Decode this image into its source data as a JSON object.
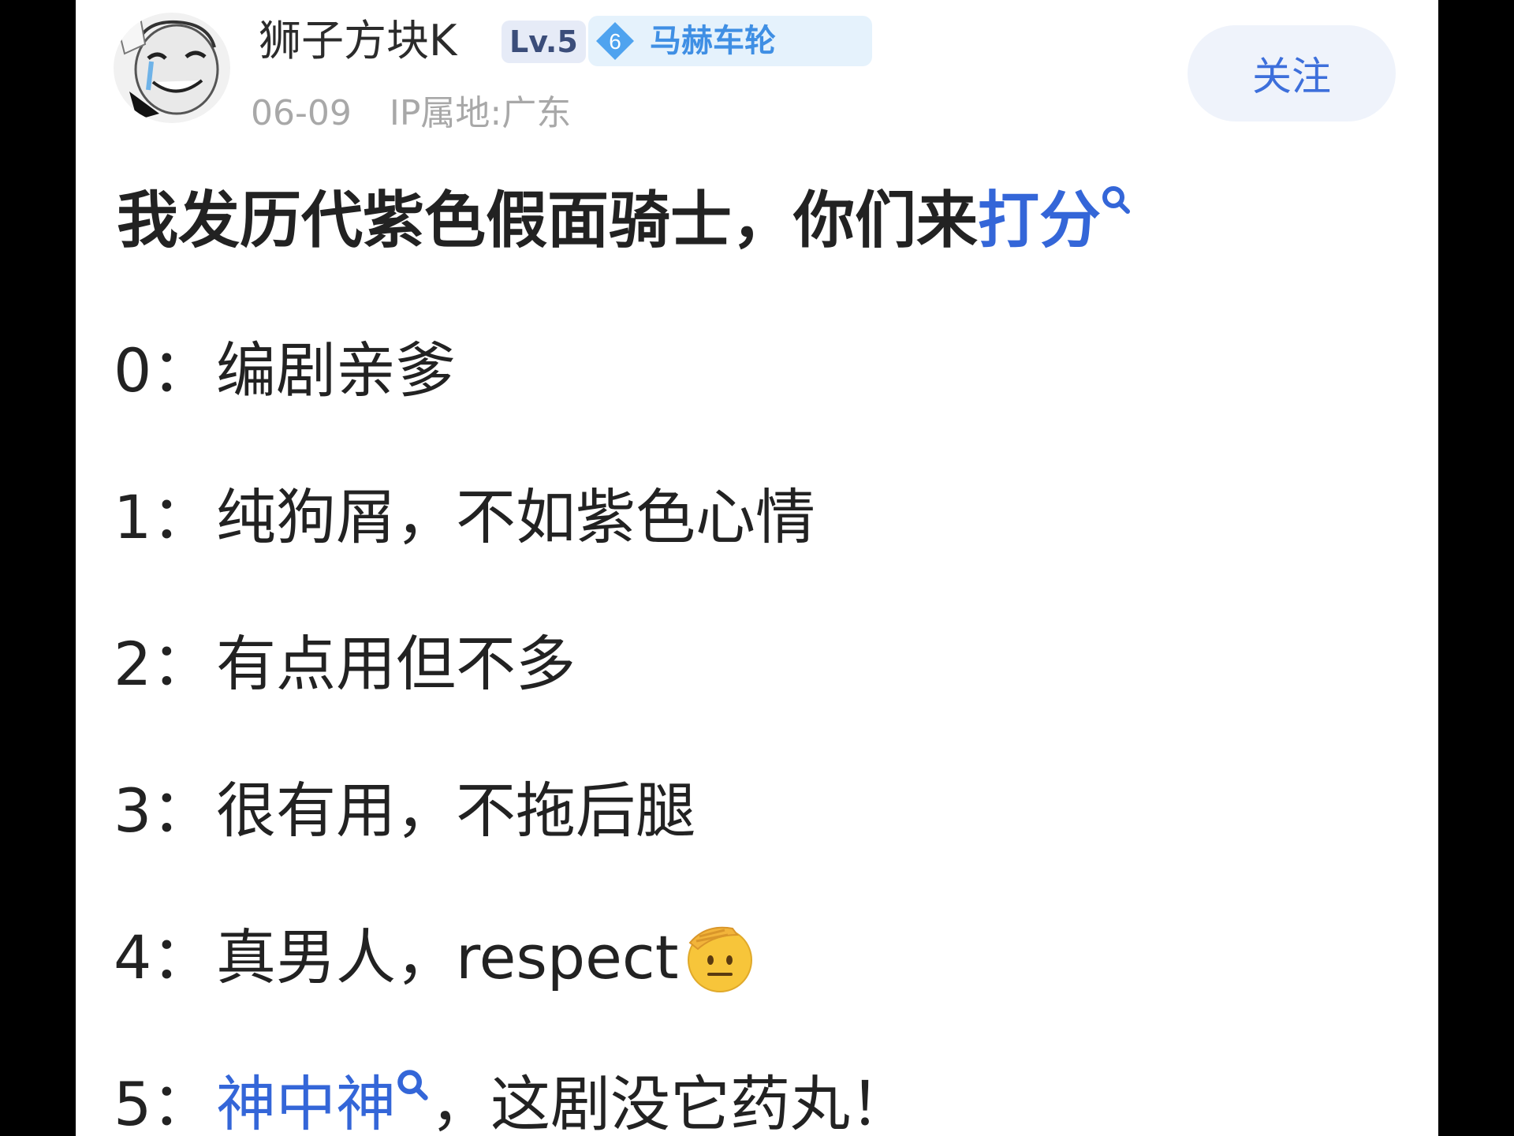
{
  "post": {
    "author": {
      "name": "狮子方块K",
      "level": "Lv.5",
      "fan_badge_level": "6",
      "fan_badge_name": "马赫车轮"
    },
    "date": "06-09",
    "ip_location": "IP属地:广东",
    "follow_label": "关注",
    "title_prefix": "我发历代紫色假面骑士，你们来",
    "title_link": "打分",
    "items": [
      {
        "num": "0：",
        "text": "编剧亲爹"
      },
      {
        "num": "1：",
        "text": "纯狗屑，不如紫色心情"
      },
      {
        "num": "2：",
        "text": "有点用但不多"
      },
      {
        "num": "3：",
        "text": "很有用，不拖后腿"
      },
      {
        "num": "4：",
        "text": "真男人，respect",
        "emoji": "salute-face"
      },
      {
        "num": "5：",
        "link": "神中神",
        "text": "，这剧没它药丸！"
      }
    ]
  },
  "colors": {
    "link": "#3466d8",
    "follow_text": "#3d6fdb",
    "follow_bg": "#eff3fb",
    "fan_badge": "#3f8fe4",
    "meta": "#a8a8a8"
  }
}
